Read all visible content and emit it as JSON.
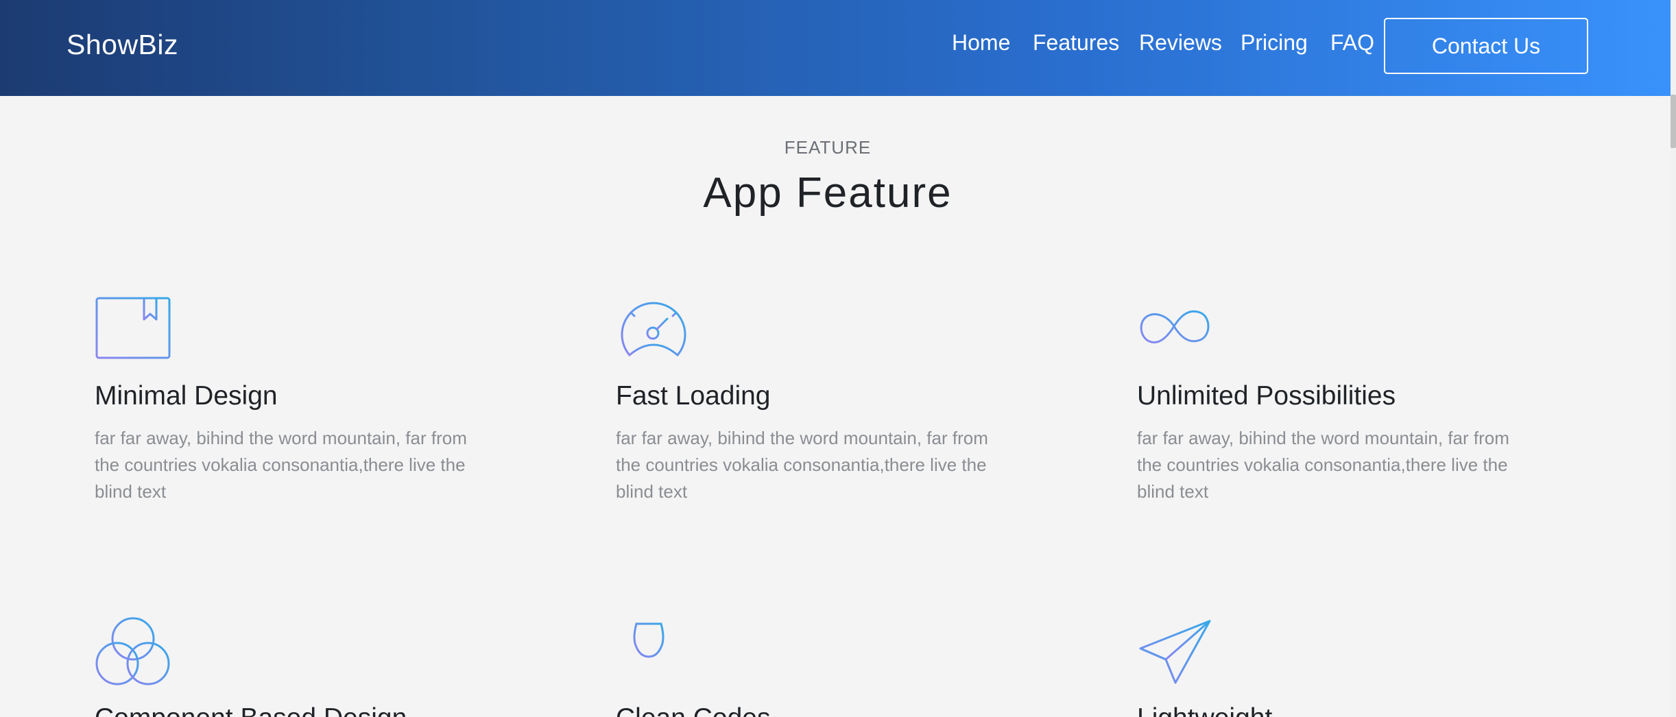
{
  "header": {
    "brand": "ShowBiz",
    "nav": [
      {
        "label": "Home"
      },
      {
        "label": "Features"
      },
      {
        "label": "Reviews"
      },
      {
        "label": "Pricing"
      },
      {
        "label": "FAQ"
      }
    ],
    "contact_label": "Contact Us"
  },
  "section": {
    "eyebrow": "FEATURE",
    "title": "App Feature"
  },
  "features": [
    {
      "title": "Minimal Design",
      "text": "far far away, bihind the word mountain, far from the countries vokalia consonantia,there live the blind text",
      "icon": "book-icon"
    },
    {
      "title": "Fast Loading",
      "text": "far far away, bihind the word mountain, far from the countries vokalia consonantia,there live the blind text",
      "icon": "speedometer-icon"
    },
    {
      "title": "Unlimited Possibilities",
      "text": "far far away, bihind the word mountain, far from the countries vokalia consonantia,there live the blind text",
      "icon": "infinity-icon"
    },
    {
      "title": "Component Based Design",
      "text": "",
      "icon": "circles-icon"
    },
    {
      "title": "Clean Codes",
      "text": "",
      "icon": "wine-glass-icon"
    },
    {
      "title": "Lightweight",
      "text": "",
      "icon": "paper-plane-icon"
    }
  ],
  "colors": {
    "header_start": "#1c3b72",
    "header_end": "#3992fb",
    "icon_start": "#7f8cf2",
    "icon_end": "#3fa6ea",
    "background": "#f4f4f4"
  }
}
